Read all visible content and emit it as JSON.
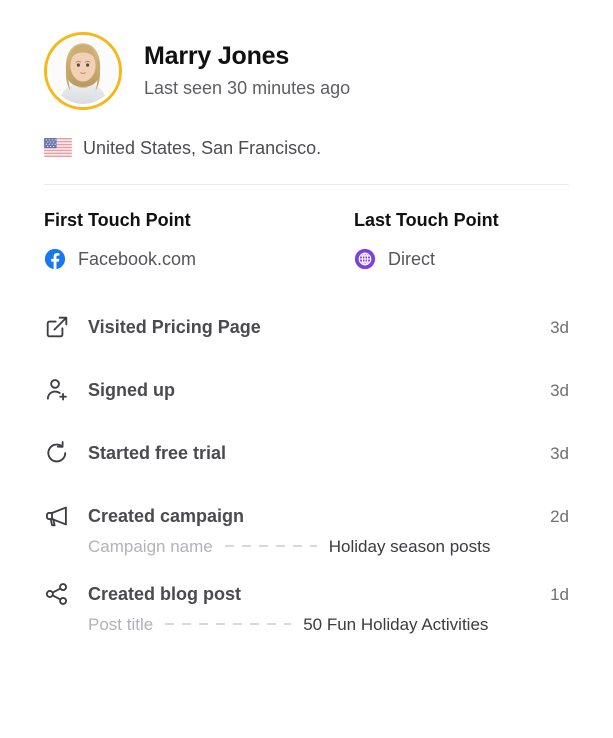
{
  "profile": {
    "name": "Marry Jones",
    "last_seen": "Last seen 30 minutes ago",
    "avatar_icon": "user-avatar-photo",
    "avatar_ring_color": "#F6B91C"
  },
  "location": {
    "flag_icon": "united-states-flag-icon",
    "text": "United States, San Francisco."
  },
  "touch_points": {
    "first": {
      "title": "First Touch Point",
      "source": "Facebook.com",
      "icon": "facebook-icon",
      "icon_color": "#1877F2"
    },
    "last": {
      "title": "Last Touch Point",
      "source": "Direct",
      "icon": "globe-icon",
      "icon_color": "#7B3FE4"
    }
  },
  "events": [
    {
      "icon": "external-link-icon",
      "label": "Visited Pricing Page",
      "time": "3d"
    },
    {
      "icon": "user-plus-icon",
      "label": "Signed up",
      "time": "3d"
    },
    {
      "icon": "refresh-circle-icon",
      "label": "Started free trial",
      "time": "3d"
    },
    {
      "icon": "megaphone-icon",
      "label": "Created campaign",
      "time": "2d",
      "detail_key": "Campaign name",
      "detail_value": "Holiday season posts"
    },
    {
      "icon": "share-nodes-icon",
      "label": "Created blog post",
      "time": "1d",
      "detail_key": "Post title",
      "detail_value": "50 Fun Holiday Activities"
    }
  ]
}
